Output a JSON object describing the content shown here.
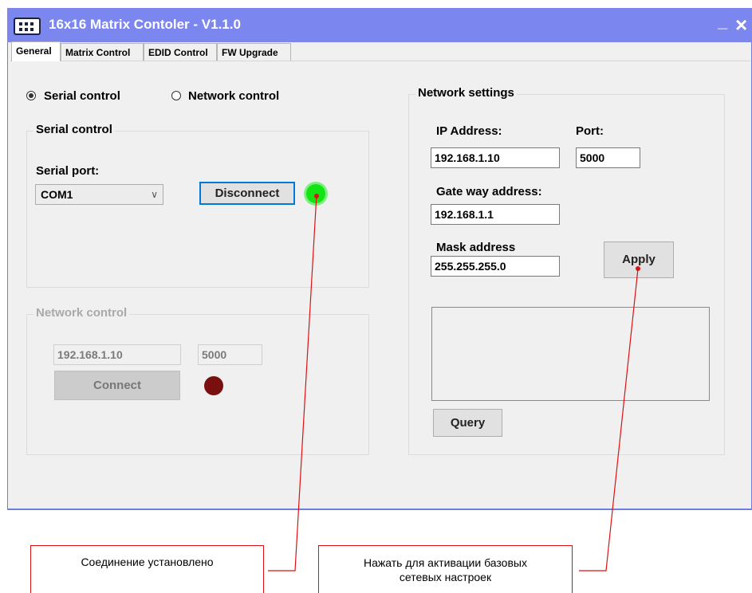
{
  "window": {
    "title": "16x16 Matrix Contoler - V1.1.0",
    "minimize_label": "_",
    "close_label": "×"
  },
  "tabs": [
    {
      "label": "General",
      "active": true
    },
    {
      "label": "Matrix Control",
      "active": false
    },
    {
      "label": "EDID Control",
      "active": false
    },
    {
      "label": "FW Upgrade",
      "active": false
    }
  ],
  "mode": {
    "serial_label": "Serial control",
    "network_label": "Network control",
    "selected": "serial"
  },
  "serial_group": {
    "legend": "Serial control",
    "port_label": "Serial port:",
    "port_value": "COM1",
    "disconnect_label": "Disconnect",
    "status_color": "#14e314"
  },
  "network_group": {
    "legend": "Network control",
    "ip_value": "192.168.1.10",
    "port_value": "5000",
    "connect_label": "Connect",
    "status_color": "#7a0f0f"
  },
  "network_settings": {
    "legend": "Network settings",
    "ip_label": "IP Address:",
    "ip_value": "192.168.1.10",
    "port_label": "Port:",
    "port_value": "5000",
    "gateway_label": "Gate way address:",
    "gateway_value": "192.168.1.1",
    "mask_label": "Mask address",
    "mask_value": "255.255.255.0",
    "apply_label": "Apply",
    "query_label": "Query"
  },
  "annotations": {
    "connected": "Соединение установлено",
    "apply_hint_line1": "Нажать для активации базовых",
    "apply_hint_line2": "сетевых настроек",
    "line_color": "#dd1111"
  }
}
